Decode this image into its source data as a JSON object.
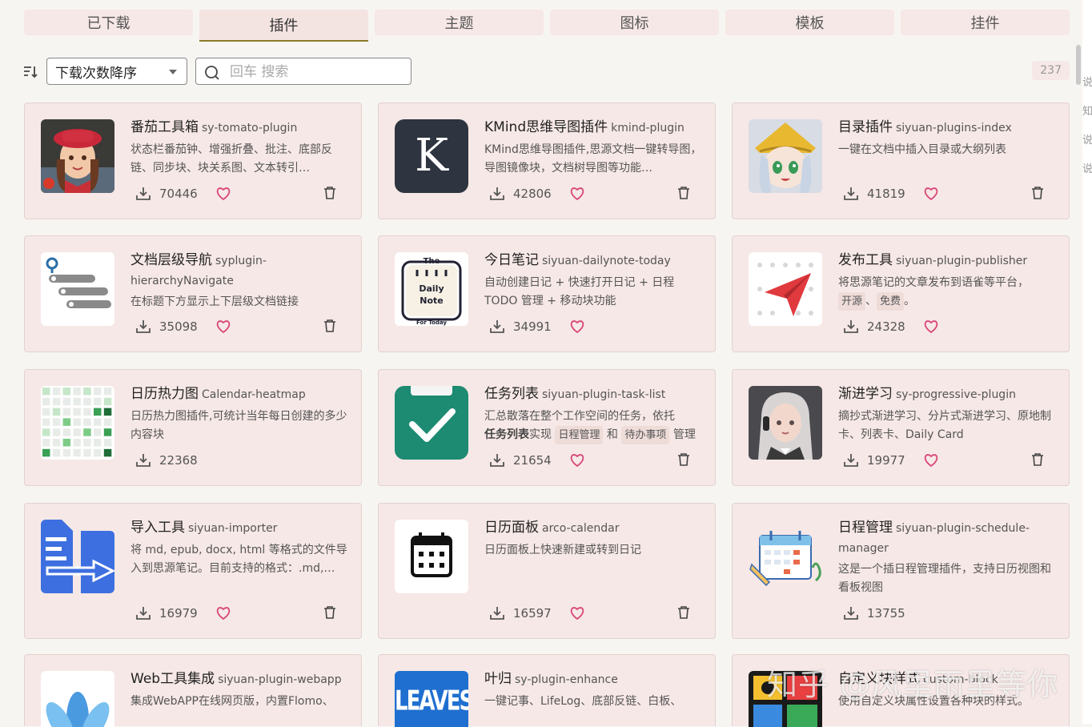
{
  "tabs": [
    {
      "label": "已下载"
    },
    {
      "label": "插件",
      "active": true
    },
    {
      "label": "主题"
    },
    {
      "label": "图标"
    },
    {
      "label": "模板"
    },
    {
      "label": "挂件"
    }
  ],
  "toolbar": {
    "sort_label": "下载次数降序",
    "search_placeholder": "回车 搜索",
    "total_count": "237"
  },
  "plugins": [
    {
      "name": "番茄工具箱",
      "pkg": "sy-tomato-plugin",
      "desc": "状态栏番茄钟、增强折叠、批注、底部反链、同步块、块关系图、文本转引…",
      "downloads": "70446",
      "icon": "avatar-girl-red-hat"
    },
    {
      "name": "KMind思维导图插件",
      "pkg": "kmind-plugin",
      "desc": "KMind思维导图插件,思源文档一键转导图，导图镜像块，文档树导图等功能…",
      "downloads": "42806",
      "icon": "letter-k-logo",
      "icon_letter": "K"
    },
    {
      "name": "目录插件",
      "pkg": "siyuan-plugins-index",
      "desc": "一键在文档中插入目录或大纲列表",
      "downloads": "41819",
      "icon": "anime-girl-yellow-hat"
    },
    {
      "name": "文档层级导航",
      "pkg": "syplugin-hierarchyNavigate",
      "desc": "在标题下方显示上下层级文档链接",
      "downloads": "35098",
      "icon": "hierarchy-list-icon"
    },
    {
      "name": "今日笔记",
      "pkg": "siyuan-dailynote-today",
      "desc": "自动创建日记 + 快速打开日记 + 日程 TODO 管理 + 移动块功能",
      "downloads": "34991",
      "icon": "daily-note-icon",
      "icon_text": [
        "The",
        "Daily",
        "Note",
        "For Today"
      ]
    },
    {
      "name": "发布工具",
      "pkg": "siyuan-plugin-publisher",
      "desc": "将思源笔记的文章发布到语雀等平台，",
      "tags": [
        "开源",
        "免费"
      ],
      "tag_sep": "、",
      "tag_end": "。",
      "downloads": "24328",
      "icon": "paper-plane-icon"
    },
    {
      "name": "日历热力图",
      "pkg": "Calendar-heatmap",
      "desc": "日历热力图插件,可统计当年每日创建的多少内容块",
      "downloads": "22368",
      "icon": "heatmap-grid-icon"
    },
    {
      "name": "任务列表",
      "pkg": "siyuan-plugin-task-list",
      "desc_parts": [
        "汇总散落在整个工作空间的任务，依托",
        "任务列表",
        "实现",
        "日程管理",
        "和",
        "待办事项",
        "管理"
      ],
      "downloads": "21654",
      "icon": "checkmark-clipboard-icon"
    },
    {
      "name": "渐进学习",
      "pkg": "sy-progressive-plugin",
      "desc": "摘抄式渐进学习、分片式渐进学习、原地制卡、列表卡、Daily Card",
      "downloads": "19977",
      "icon": "avatar-girl-headphones"
    },
    {
      "name": "导入工具",
      "pkg": "siyuan-importer",
      "desc": "将 md, epub, docx, html 等格式的文件导入到思源笔记。目前支持的格式：.md,…",
      "downloads": "16979",
      "icon": "import-document-icon"
    },
    {
      "name": "日历面板",
      "pkg": "arco-calendar",
      "desc": "日历面板上快速新建或转到日记",
      "downloads": "16597",
      "icon": "calendar-icon"
    },
    {
      "name": "日程管理",
      "pkg": "siyuan-plugin-schedule-manager",
      "desc": "这是一个插日程管理插件，支持日历视图和看板视图",
      "downloads": "13755",
      "icon": "schedule-calendar-icon"
    },
    {
      "name": "Web工具集成",
      "pkg": "siyuan-plugin-webapp",
      "desc": "集成WebAPP在线网页版，内置Flomo、",
      "icon": "blue-petals-icon"
    },
    {
      "name": "叶归",
      "pkg": "sy-plugin-enhance",
      "desc": "一键记事、LifeLog、底部反链、白板、",
      "icon": "leaves-logo",
      "icon_text": "LEAVES"
    },
    {
      "name": "自定义块样式",
      "pkg": "custom-block",
      "desc": "使用自定义块属性设置各种块的样式。",
      "icon": "puzzle-blocks-icon"
    }
  ],
  "watermark": "知乎 @风里雨里等你",
  "right_edge_chars": [
    "说",
    "知",
    "说",
    "说"
  ],
  "colors": {
    "card_bg": "#f6e8e6",
    "heart": "#d9477a",
    "accent": "#8b7b28"
  }
}
